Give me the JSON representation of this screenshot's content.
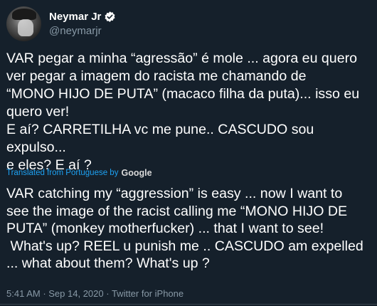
{
  "author": {
    "display_name": "Neymar Jr",
    "handle": "@neymarjr",
    "verified": true
  },
  "tweet": {
    "text": "VAR pegar a minha “agressão” é mole ... agora eu quero\nver pegar a imagem do racista me chamando de\n“MONO HIJO DE PUTA” (macaco filha da puta)... isso eu\nquero ver!\nE aí? CARRETILHA vc me pune.. CASCUDO sou expulso...\ne eles? E aí ?",
    "translated_label": "Translated from Portuguese by",
    "translator_logo": "Google",
    "translated_text": "VAR catching my “aggression” is easy ... now I want to\nsee the image of the racist calling me “MONO HIJO DE\nPUTA” (monkey motherfucker) ... that I want to see!\n What's up? REEL u punish me .. CASCUDO am expelled\n... what about them? What's up ?"
  },
  "meta": {
    "time": "5:41 AM",
    "separator": " · ",
    "date": "Sep 14, 2020",
    "source": "Twitter for iPhone"
  },
  "colors": {
    "background": "#15202b",
    "primary_text": "#ffffff",
    "secondary_text": "#8899a6",
    "link": "#1da1f2",
    "verified_badge": "#ffffff"
  },
  "icons": {
    "verified": "verified-badge-icon"
  }
}
